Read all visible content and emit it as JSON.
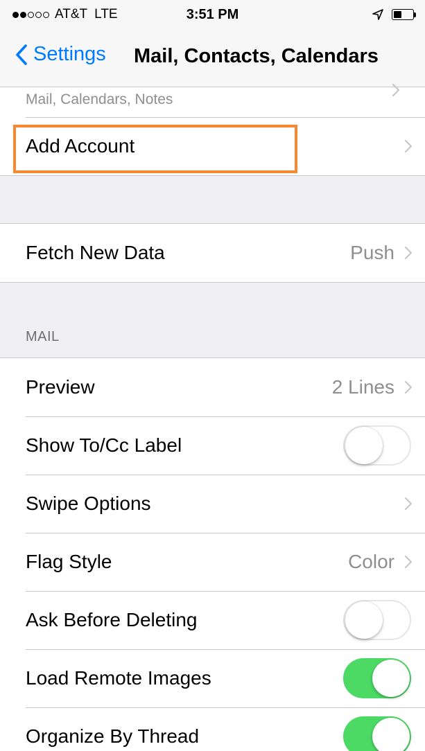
{
  "status_bar": {
    "carrier": "AT&T",
    "network": "LTE",
    "time": "3:51 PM",
    "signal_strength": 2,
    "signal_max": 5,
    "location_icon": "location-arrow-icon",
    "battery_level": 0.45
  },
  "nav": {
    "back_label": "Settings",
    "title": "Mail, Contacts, Calendars"
  },
  "accounts": {
    "partial_subtitle": "Mail, Calendars, Notes",
    "add_account_label": "Add Account"
  },
  "fetch": {
    "label": "Fetch New Data",
    "value": "Push"
  },
  "mail_section": {
    "header": "MAIL",
    "preview": {
      "label": "Preview",
      "value": "2 Lines"
    },
    "show_to_cc": {
      "label": "Show To/Cc Label",
      "on": false
    },
    "swipe_options": {
      "label": "Swipe Options"
    },
    "flag_style": {
      "label": "Flag Style",
      "value": "Color"
    },
    "ask_before_deleting": {
      "label": "Ask Before Deleting",
      "on": false
    },
    "load_remote_images": {
      "label": "Load Remote Images",
      "on": true
    },
    "organize_by_thread": {
      "label": "Organize By Thread",
      "on": true
    }
  },
  "colors": {
    "accent": "#007aff",
    "switch_on": "#4cd964",
    "highlight": "#f7882f",
    "group_background": "#efeff4"
  }
}
